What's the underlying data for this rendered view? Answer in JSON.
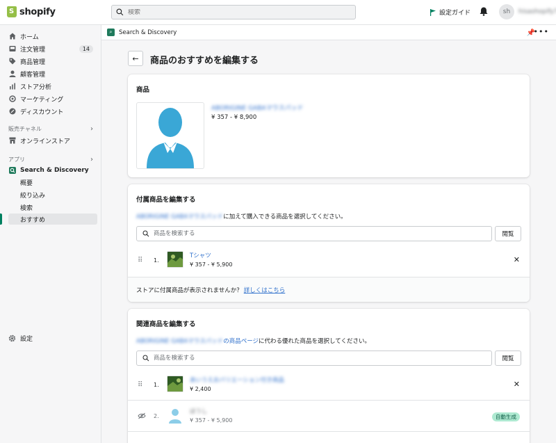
{
  "topbar": {
    "logo_text": "shopify",
    "search_placeholder": "検索",
    "setup_guide": "設定ガイド",
    "avatar_initials": "sh",
    "store_name": "hisashopify7"
  },
  "sidebar": {
    "items": [
      {
        "label": "ホーム",
        "icon": "home-icon"
      },
      {
        "label": "注文管理",
        "icon": "orders-icon",
        "badge": "14"
      },
      {
        "label": "商品管理",
        "icon": "tag-icon"
      },
      {
        "label": "顧客管理",
        "icon": "person-icon"
      },
      {
        "label": "ストア分析",
        "icon": "analytics-icon"
      },
      {
        "label": "マーケティング",
        "icon": "marketing-icon"
      },
      {
        "label": "ディスカウント",
        "icon": "discount-icon"
      }
    ],
    "sales_channels_label": "販売チャネル",
    "online_store": "オンラインストア",
    "apps_label": "アプリ",
    "app_name": "Search & Discovery",
    "app_subitems": [
      "概要",
      "絞り込み",
      "検索",
      "おすすめ"
    ],
    "settings": "設定"
  },
  "appbar": {
    "title": "Search & Discovery"
  },
  "page": {
    "title": "商品のおすすめを編集する"
  },
  "product_card": {
    "title": "商品",
    "product_name": "ABORIGINE GABAマウスパッド",
    "price": "¥ 357 - ¥ 8,900"
  },
  "complementary_card": {
    "title": "付属商品を編集する",
    "desc_blurred": "ABORIGINE GABAマウスパッド",
    "desc_rest": "に加えて購入できる商品を選択してください。",
    "search_placeholder": "商品を検索する",
    "browse": "閲覧",
    "items": [
      {
        "index": "1.",
        "name": "Tシャツ",
        "price": "¥ 357 - ¥ 5,900"
      }
    ],
    "footer_text": "ストアに付属商品が表示されませんか？",
    "footer_link": "詳しくはこちら"
  },
  "related_card": {
    "title": "関連商品を編集する",
    "desc_blurred": "ABORIGINE GABAマウスパッド",
    "desc_link": "の商品ページ",
    "desc_rest": "に代わる優れた商品を選択してください。",
    "search_placeholder": "商品を検索する",
    "browse": "閲覧",
    "items": [
      {
        "index": "1.",
        "name": "あいうえおバリエーション付き商品",
        "price": "¥ 2,400"
      },
      {
        "index": "2.",
        "name": "ぼうし",
        "price": "¥ 357 - ¥ 5,900",
        "badge": "自動生成"
      }
    ]
  },
  "colors": {
    "accent": "#008060",
    "link": "#2c6ecb",
    "avatar_blue": "#3aa7d6",
    "auto_badge_bg": "#aee9d1"
  }
}
